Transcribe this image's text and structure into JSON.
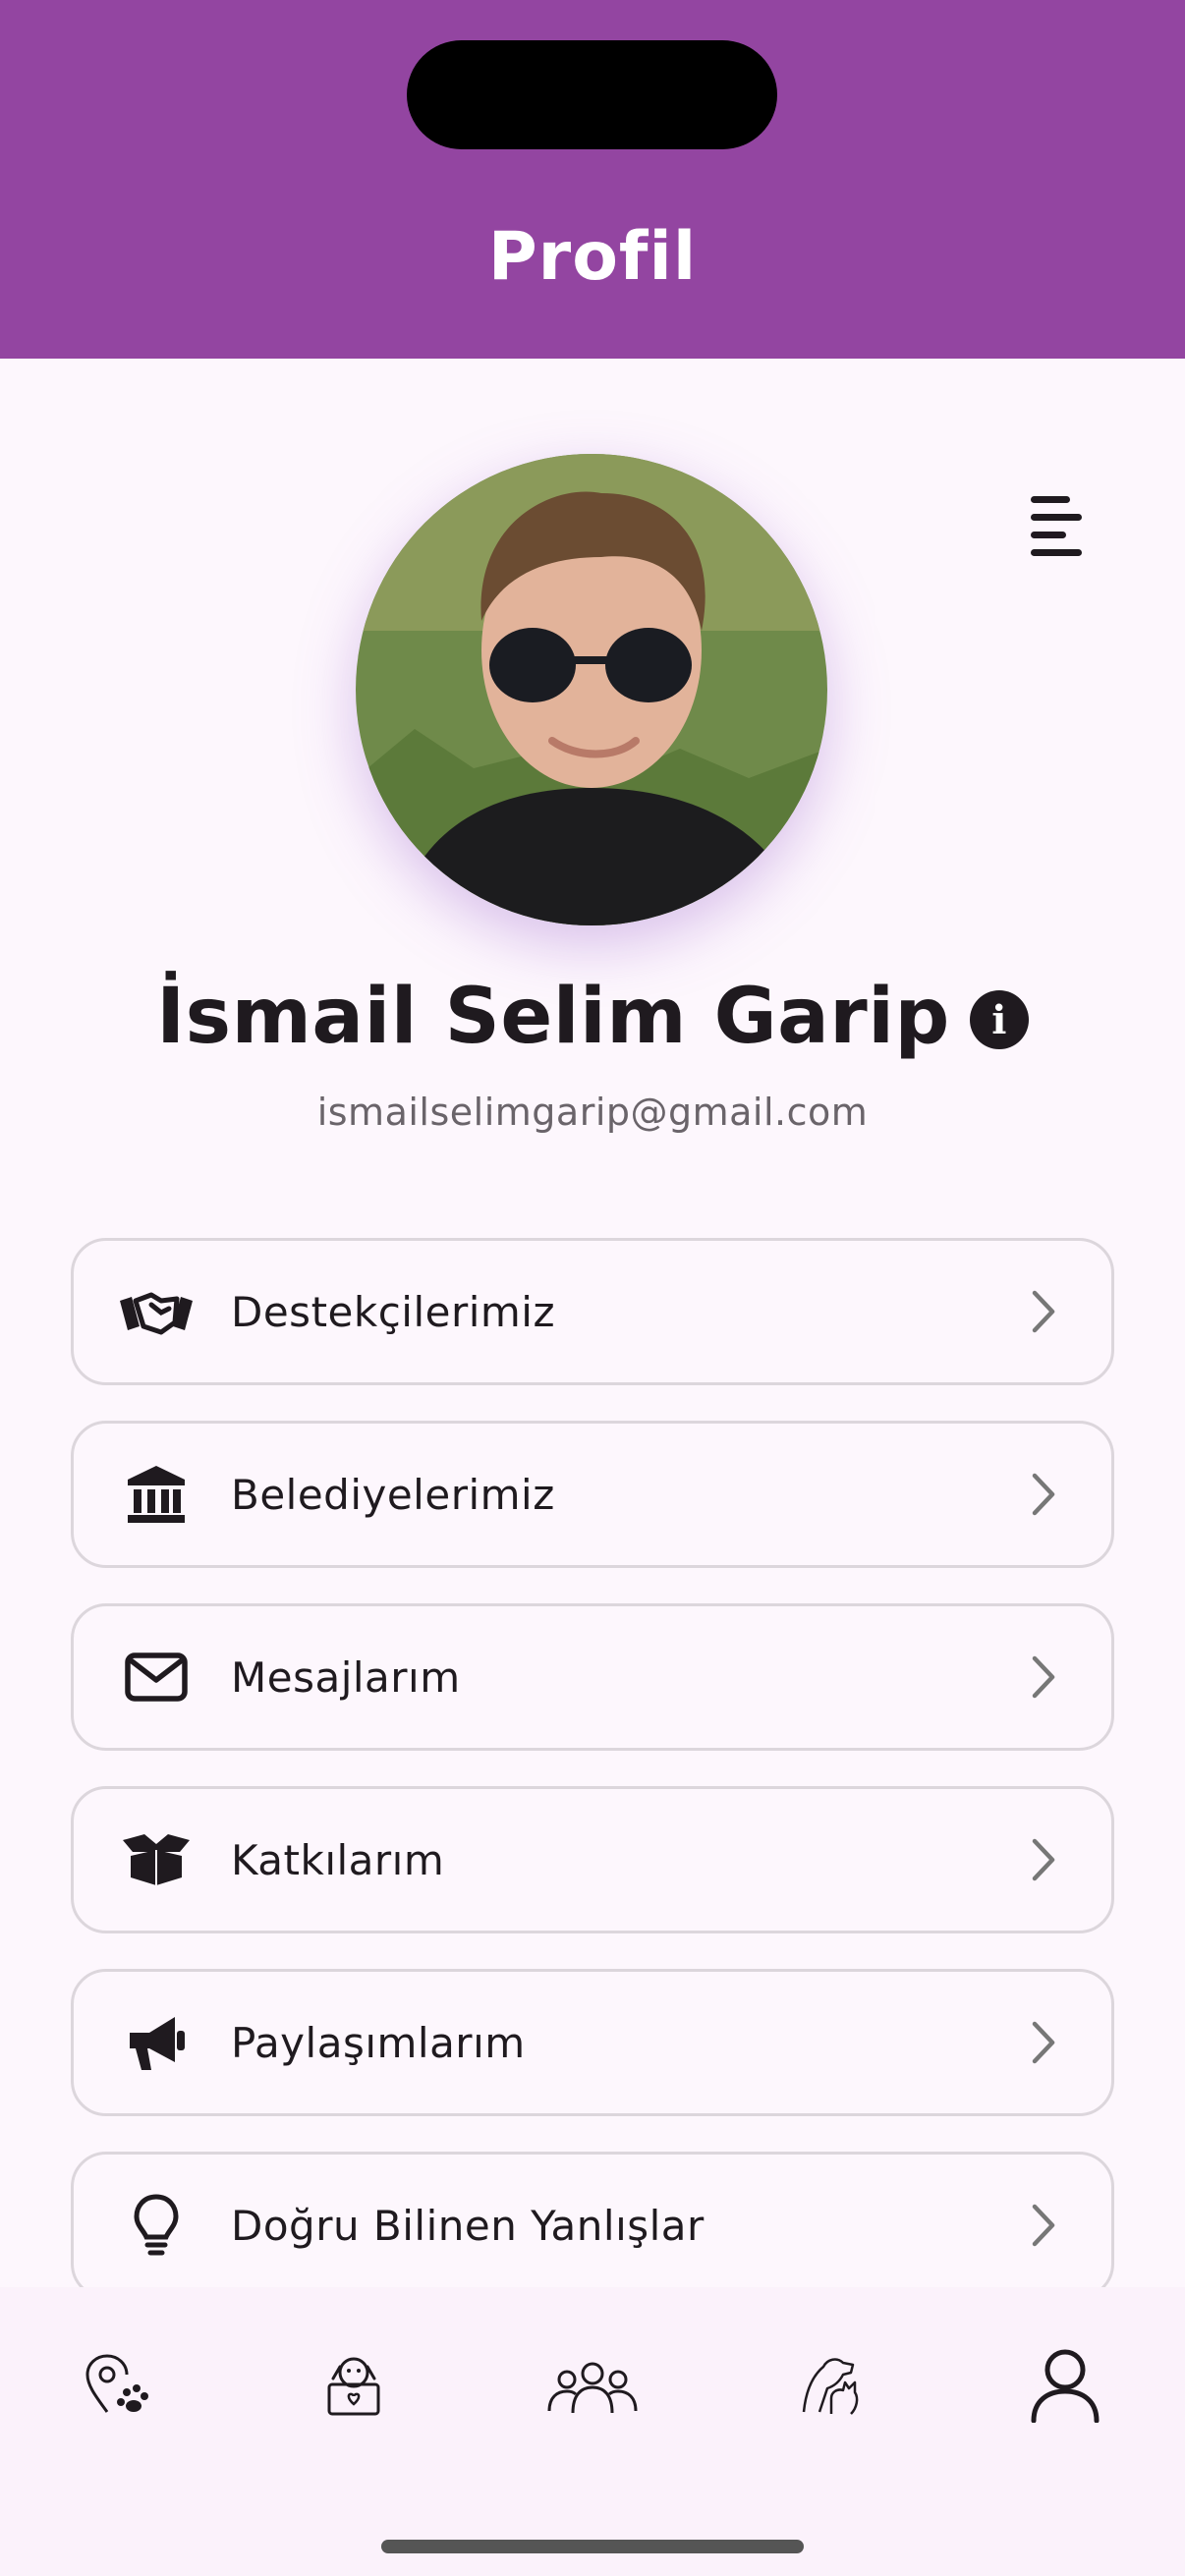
{
  "header": {
    "title": "Profil"
  },
  "profile": {
    "name": "İsmail Selim Garip",
    "email": "ismailselimgarip@gmail.com"
  },
  "menu": [
    {
      "label": "Destekçilerimiz",
      "icon": "handshake-icon"
    },
    {
      "label": "Belediyelerimiz",
      "icon": "bank-icon"
    },
    {
      "label": "Mesajlarım",
      "icon": "envelope-icon"
    },
    {
      "label": "Katkılarım",
      "icon": "open-box-icon"
    },
    {
      "label": "Paylaşımlarım",
      "icon": "megaphone-icon"
    },
    {
      "label": "Doğru Bilinen Yanlışlar",
      "icon": "lightbulb-icon"
    }
  ],
  "bottom_nav": [
    {
      "icon": "location-paw-icon",
      "active": false
    },
    {
      "icon": "dog-adoption-icon",
      "active": false
    },
    {
      "icon": "community-icon",
      "active": false
    },
    {
      "icon": "pets-icon",
      "active": false
    },
    {
      "icon": "profile-icon",
      "active": true
    }
  ],
  "colors": {
    "header_bg": "#9345a1",
    "page_bg": "#fdf7fd",
    "text": "#1f1a1f"
  }
}
